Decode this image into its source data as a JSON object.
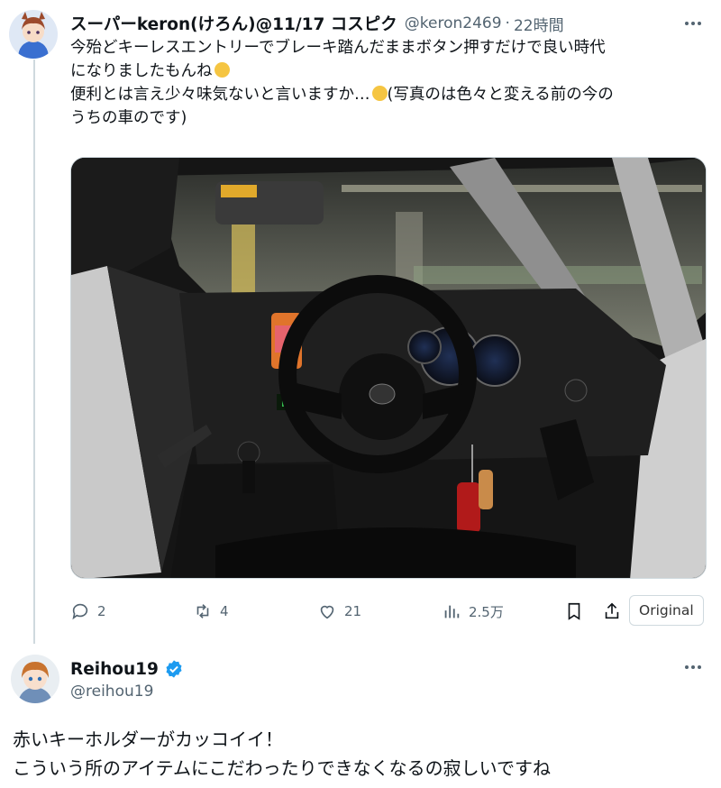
{
  "tweet1": {
    "display_name": "スーパーkeron(けろん)@11/17 コスピク",
    "handle": "@keron2469",
    "separator": "·",
    "time": "22時間",
    "text_lines": [
      "今殆どキーレスエントリーでブレーキ踏んだままボタン押すだけで良い時代",
      "になりましたもんね",
      "便利とは言え少々味気ないと言いますか…",
      "(写真のは色々と変える前の今の",
      "うちの車のです)"
    ],
    "photo_icon": "car-interior-photo",
    "stats": {
      "replies": "2",
      "reposts": "4",
      "likes": "21",
      "views": "2.5万"
    },
    "original_button": "Original"
  },
  "tweet2": {
    "display_name": "Reihou19",
    "handle": "@reihou19",
    "verified_icon": "verified-badge-icon",
    "text_lines": [
      "赤いキーホルダーがカッコイイ！",
      "こういう所のアイテムにこだわったりできなくなるの寂しいですね"
    ]
  },
  "colors": {
    "text": "#0f1419",
    "secondary": "#536471",
    "verified": "#1d9bf0",
    "border": "#cfd9de"
  }
}
